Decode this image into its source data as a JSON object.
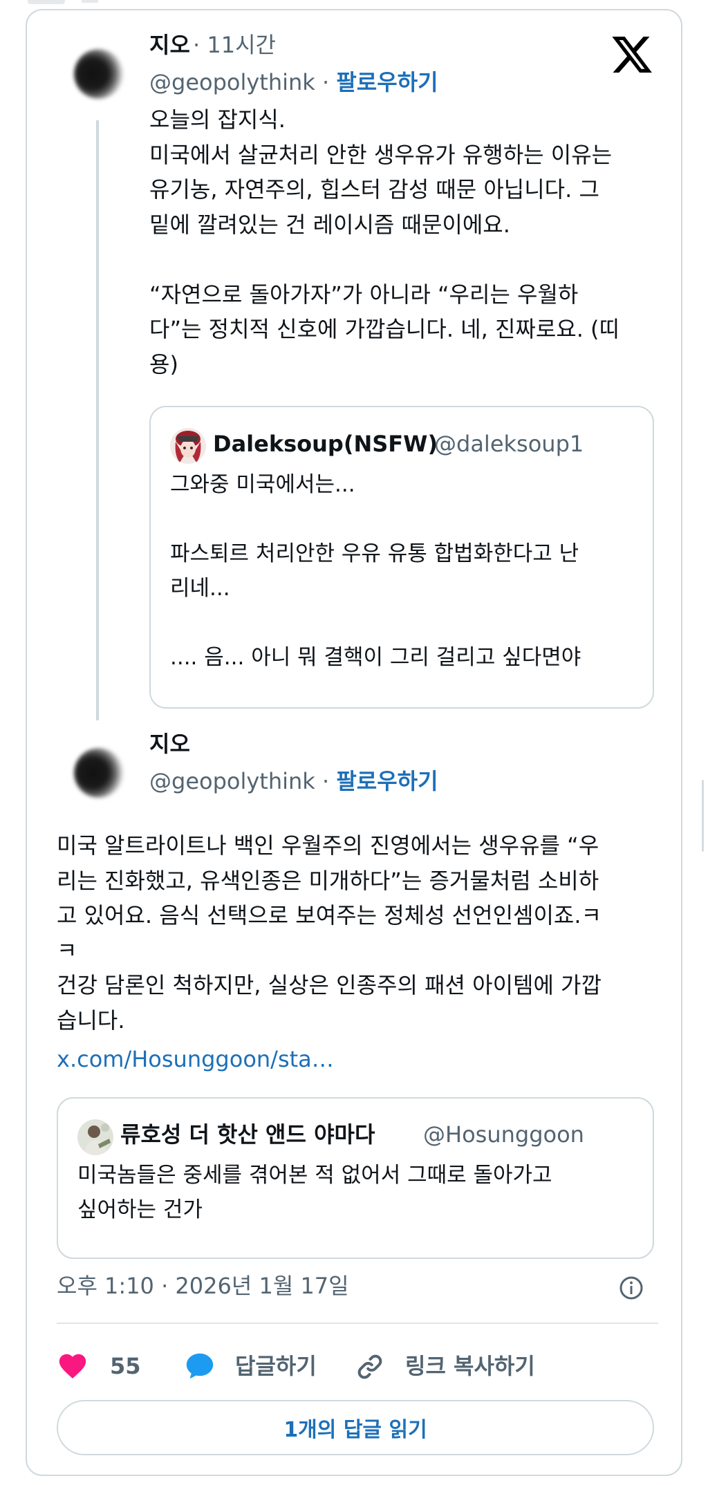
{
  "main_tweet": {
    "author_name": "지오",
    "time_ago": "· 11시간",
    "handle": "@geopolythink",
    "separator": " · ",
    "follow_label": "팔로우하기",
    "text": "오늘의 잡지식.\n미국에서 살균처리 안한 생우유가 유행하는 이유는\n유기농, 자연주의, 힙스터 감성 때문 아닙니다. 그\n밑에 깔려있는 건 레이시즘 때문이에요.\n\n“자연으로 돌아가자”가 아니라 “우리는 우월하\n다”는 정치적 신호에 가깝습니다. 네, 진짜로요. (띠\n용)",
    "quote": {
      "name": "Daleksoup(NSFW)",
      "handle": "@daleksoup1",
      "text": "그와중 미국에서는...\n\n파스퇴르 처리안한 우유 유통 합법화한다고 난\n리네...\n\n.... 음... 아니 뭐 결핵이 그리 걸리고 싶다면야"
    }
  },
  "reply_tweet": {
    "author_name": "지오",
    "handle": "@geopolythink",
    "separator": " · ",
    "follow_label": "팔로우하기",
    "text": "미국 알트라이트나 백인 우월주의 진영에서는 생우유를 “우\n리는 진화했고, 유색인종은 미개하다”는 증거물처럼 소비하\n고 있어요. 음식 선택으로 보여주는 정체성 선언인셈이죠.ㅋ\nㅋ\n건강 담론인 척하지만, 실상은 인종주의 패션 아이템에 가깝\n습니다.",
    "link": "x.com/Hosunggoon/sta…",
    "quote": {
      "name": "류호성 더 핫산 앤드 야마다",
      "handle": "@Hosunggoon",
      "text": "미국놈들은 중세를 겪어본 적 없어서 그때로 돌아가고\n싶어하는 건가"
    },
    "timestamp": "오후 1:10 · 2026년 1월 17일"
  },
  "actions": {
    "like_count": "55",
    "reply_label": "답글하기",
    "copy_link_label": "링크 복사하기",
    "read_replies_label": "1개의 답글 읽기"
  },
  "icons": {
    "logo": "x-logo-icon",
    "like": "heart-icon",
    "reply": "speech-bubble-icon",
    "copy": "link-icon",
    "info": "info-icon"
  },
  "colors": {
    "accent_link": "#1d6fb8",
    "like": "#f91880",
    "reply_icon": "#1d9bf0",
    "muted_text": "#536471",
    "border": "#cfd9de"
  }
}
